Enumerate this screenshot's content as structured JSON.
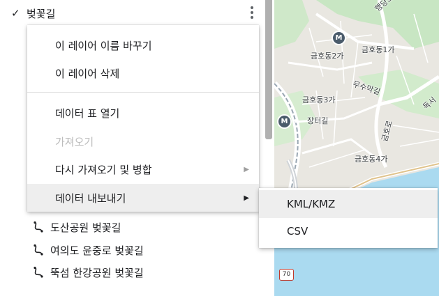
{
  "layer": {
    "title": "벚꽃길",
    "checked_glyph": "✓",
    "features": [
      {
        "label": "도산공원 벚꽃길",
        "icon": "line-path-icon"
      },
      {
        "label": "여의도 윤중로 벚꽃길",
        "icon": "line-path-icon"
      },
      {
        "label": "뚝섬 한강공원 벚꽃길",
        "icon": "line-path-icon"
      }
    ]
  },
  "layer_menu": {
    "items": [
      {
        "label": "이 레이어 이름 바꾸기"
      },
      {
        "label": "이 레이어 삭제"
      },
      {
        "label": "데이터 표 열기"
      },
      {
        "label": "가져오기",
        "disabled": true
      },
      {
        "label": "다시 가져오기 및 병합",
        "submenu": true
      },
      {
        "label": "데이터 내보내기",
        "submenu": true,
        "active": true
      }
    ],
    "arrow_glyph": "▶"
  },
  "export_menu": {
    "items": [
      {
        "label": "KML/KMZ",
        "active": true
      },
      {
        "label": "CSV"
      }
    ]
  },
  "map": {
    "labels": [
      "행당로",
      "금호동1가",
      "금호동2가",
      "무수막길",
      "금호동3가",
      "장터길",
      "금호로",
      "금호동4가",
      "독서"
    ],
    "metro_glyph": "M",
    "route_number": "70"
  },
  "colors": {
    "map_land": "#e9e7e1",
    "map_green": "#c8e6c3",
    "map_water": "#aadaf0",
    "menu_active": "#eeeeee",
    "disabled_text": "#bdbdbd"
  }
}
